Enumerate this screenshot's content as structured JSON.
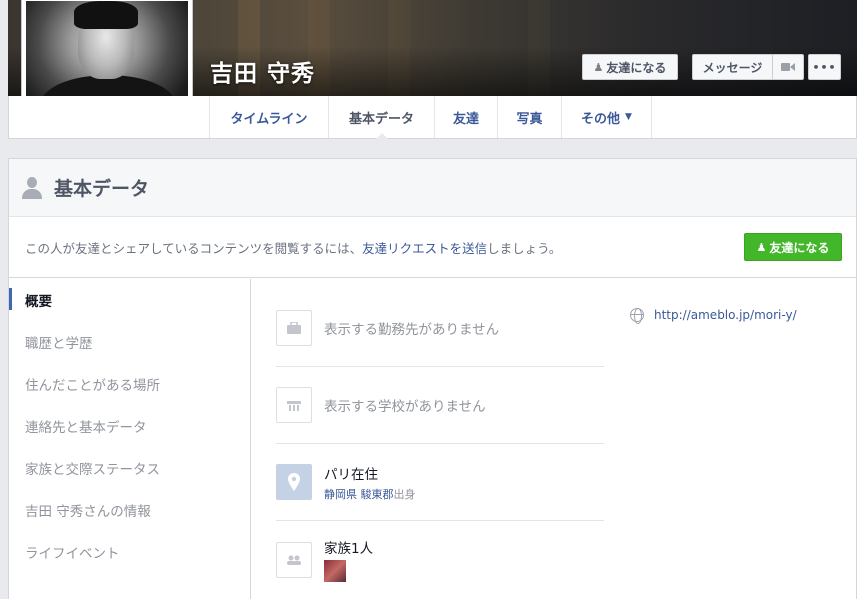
{
  "profile": {
    "name": "吉田 守秀"
  },
  "cover_actions": {
    "add_friend": "友達になる",
    "message": "メッセージ",
    "video_icon": "video-camera-icon",
    "more": "•••"
  },
  "tabs": [
    {
      "label": "タイムライン"
    },
    {
      "label": "基本データ",
      "active": true
    },
    {
      "label": "友達"
    },
    {
      "label": "写真"
    },
    {
      "label": "その他"
    }
  ],
  "about": {
    "title": "基本データ",
    "notice": {
      "before": "この人が友達とシェアしているコンテンツを閲覧するには、",
      "link": "友達リクエストを送信",
      "after": "しましょう。"
    },
    "add_friend_button": "友達になる"
  },
  "sidebar": {
    "items": [
      {
        "label": "概要"
      },
      {
        "label": "職歴と学歴"
      },
      {
        "label": "住んだことがある場所"
      },
      {
        "label": "連絡先と基本データ"
      },
      {
        "label": "家族と交際ステータス"
      },
      {
        "label": "吉田 守秀さんの情報"
      },
      {
        "label": "ライフイベント"
      }
    ]
  },
  "overview": {
    "work": "表示する勤務先がありません",
    "school": "表示する学校がありません",
    "location_title": "パリ在住",
    "hometown": {
      "pref": "静岡県",
      "district": "駿東郡",
      "suffix": "出身"
    },
    "family": "家族1人"
  },
  "website": "http://ameblo.jp/mori-y/",
  "colors": {
    "link": "#3b5998",
    "green_button": "#42b72a",
    "active_bar": "#4267b2"
  }
}
